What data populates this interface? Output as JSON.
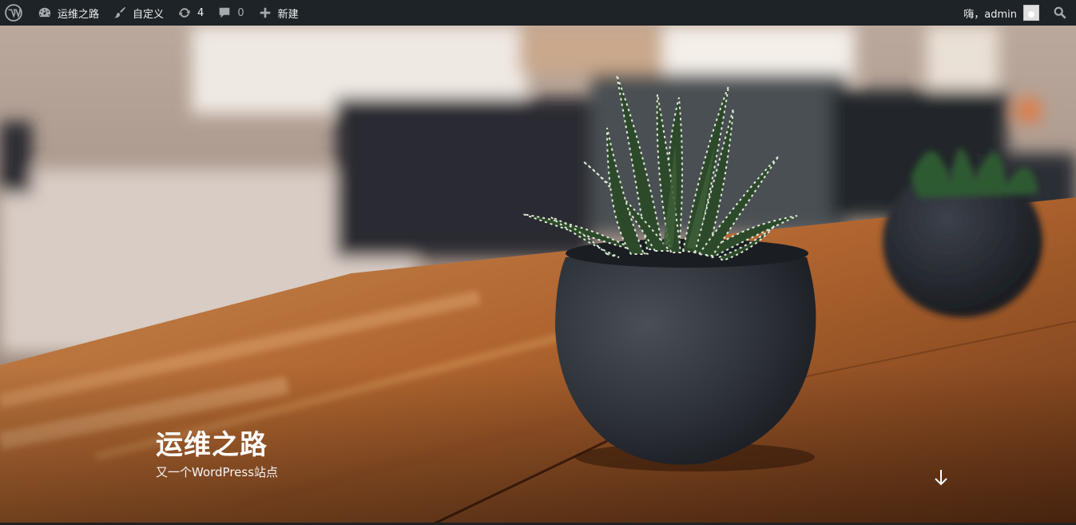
{
  "admin_bar": {
    "wp_logo_icon": "wordpress-icon",
    "site_name": "运维之路",
    "site_icon": "dashboard-icon",
    "customize_label": "自定义",
    "customize_icon": "brush-icon",
    "updates_count": "4",
    "updates_icon": "updates-icon",
    "comments_count": "0",
    "comments_icon": "comment-icon",
    "new_label": "新建",
    "new_icon": "plus-icon",
    "greeting": "嗨，admin",
    "avatar_icon": "avatar-icon",
    "search_icon": "search-icon"
  },
  "hero": {
    "site_title": "运维之路",
    "site_description": "又一个WordPress站点",
    "scroll_icon": "arrow-down-icon"
  },
  "colors": {
    "admin_bar_bg": "#1d2327",
    "admin_bar_text": "#f0f0f1",
    "admin_bar_icon": "#a7aaad",
    "title_text": "#ffffff"
  }
}
